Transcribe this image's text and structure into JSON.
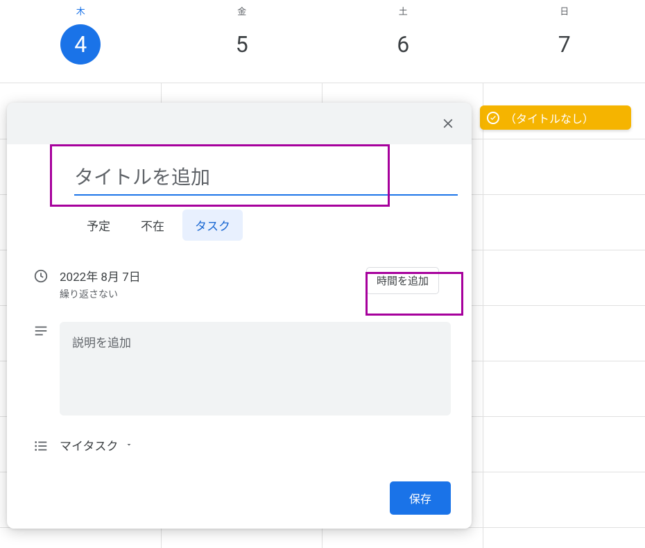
{
  "calendar": {
    "days": [
      {
        "label": "木",
        "num": "4",
        "active": true
      },
      {
        "label": "金",
        "num": "5",
        "active": false
      },
      {
        "label": "土",
        "num": "6",
        "active": false
      },
      {
        "label": "日",
        "num": "7",
        "active": false
      }
    ]
  },
  "task_chip": {
    "label": "（タイトルなし）"
  },
  "modal": {
    "title_placeholder": "タイトルを追加",
    "tabs": {
      "event": "予定",
      "ooo": "不在",
      "task": "タスク"
    },
    "active_tab": "task",
    "date_text": "2022年 8月 7日",
    "repeat_text": "繰り返さない",
    "add_time_label": "時間を追加",
    "description_placeholder": "説明を追加",
    "task_list": "マイタスク",
    "save_label": "保存"
  }
}
